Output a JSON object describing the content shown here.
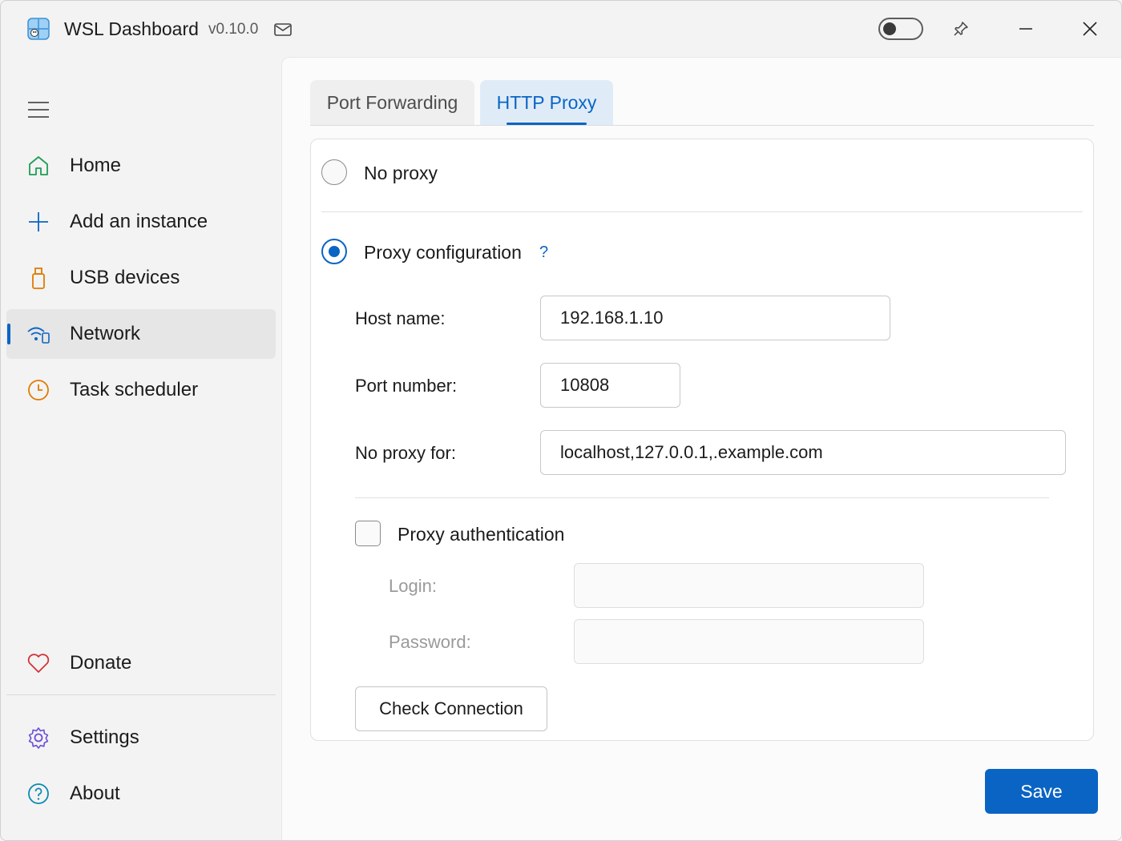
{
  "titlebar": {
    "title": "WSL Dashboard",
    "version": "v0.10.0",
    "icons": {
      "app": "wsl-app-icon",
      "mail": "mail-icon",
      "pin": "pin-icon",
      "minimize": "minimize-icon",
      "close": "close-icon"
    },
    "theme_toggle": "off"
  },
  "sidebar": {
    "menu_icon": "hamburger-icon",
    "items": [
      {
        "label": "Home",
        "icon": "home-icon",
        "color": "#1f9d55"
      },
      {
        "label": "Add an instance",
        "icon": "plus-icon",
        "color": "#0a64c4"
      },
      {
        "label": "USB devices",
        "icon": "usb-icon",
        "color": "#e07b00"
      },
      {
        "label": "Network",
        "icon": "network-icon",
        "color": "#0a64c4",
        "selected": true
      },
      {
        "label": "Task scheduler",
        "icon": "clock-icon",
        "color": "#e07b00"
      }
    ],
    "footer_items": [
      {
        "label": "Donate",
        "icon": "heart-icon",
        "color": "#d13438"
      },
      {
        "label": "Settings",
        "icon": "gear-icon",
        "color": "#6b4fd6"
      },
      {
        "label": "About",
        "icon": "help-circle-icon",
        "color": "#0a8ab0"
      }
    ]
  },
  "tabs": [
    {
      "label": "Port Forwarding",
      "active": false
    },
    {
      "label": "HTTP Proxy",
      "active": true
    }
  ],
  "proxy": {
    "no_proxy_label": "No proxy",
    "config_label": "Proxy configuration",
    "help_text": "?",
    "selected": "Proxy configuration",
    "host_label": "Host name:",
    "host_value": "192.168.1.10",
    "port_label": "Port number:",
    "port_value": "10808",
    "no_proxy_for_label": "No proxy for:",
    "no_proxy_for_value": "localhost,127.0.0.1,.example.com",
    "auth_label": "Proxy authentication",
    "auth_checked": false,
    "login_label": "Login:",
    "login_value": "",
    "password_label": "Password:",
    "password_value": "",
    "check_button": "Check Connection"
  },
  "save_button": "Save",
  "colors": {
    "accent": "#0a64c4",
    "window_bg": "#f3f3f3",
    "content_bg": "#fbfbfb"
  }
}
